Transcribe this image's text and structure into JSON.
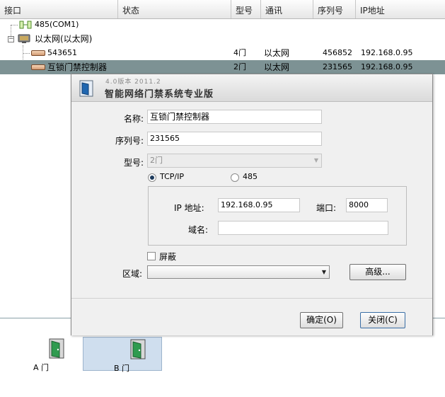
{
  "table": {
    "columns": [
      "接口",
      "状态",
      "型号",
      "通讯",
      "序列号",
      "IP地址"
    ],
    "rows": [
      {
        "name": "485(COM1)"
      },
      {
        "name": "以太网(以太网)"
      },
      {
        "name": "543651",
        "model": "4门",
        "comm": "以太网",
        "serial": "456852",
        "ip": "192.168.0.95"
      },
      {
        "name": "互锁门禁控制器",
        "model": "2门",
        "comm": "以太网",
        "serial": "231565",
        "ip": "192.168.0.95"
      }
    ]
  },
  "doors": [
    {
      "label": "A 门"
    },
    {
      "label": "B 门"
    }
  ],
  "dialog": {
    "version": "4.0版本 2011.2",
    "title": "智能网络门禁系统专业版",
    "name_label": "名称:",
    "name_value": "互锁门禁控制器",
    "serial_label": "序列号:",
    "serial_value": "231565",
    "model_label": "型号:",
    "model_value": "2门",
    "radio_tcp": "TCP/IP",
    "radio_485": "485",
    "ip_label": "IP 地址:",
    "ip_value": "192.168.0.95",
    "port_label": "端口:",
    "port_value": "8000",
    "domain_label": "域名:",
    "domain_value": "",
    "shield_label": "屏蔽",
    "zone_label": "区域:",
    "zone_value": "",
    "advanced_button": "高级...",
    "ok_button": "确定(O)",
    "close_button": "关闭(C)"
  },
  "colors": {
    "selected_row": "#7d9294",
    "selected_door": "#cfdeee"
  }
}
